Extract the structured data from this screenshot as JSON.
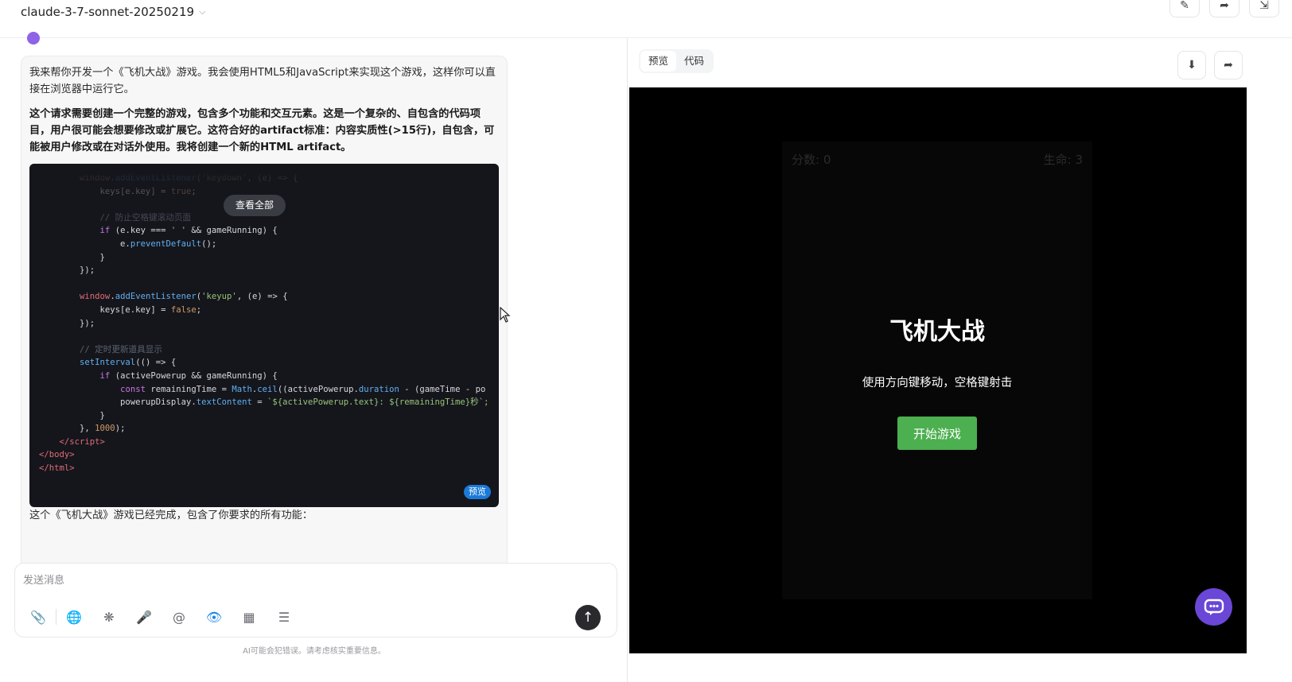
{
  "header": {
    "model_name": "claude-3-7-sonnet-20250219"
  },
  "message": {
    "intro": "我来帮你开发一个《飞机大战》游戏。我会使用HTML5和JavaScript来实现这个游戏，这样你可以直接在浏览器中运行它。",
    "bold_note": "这个请求需要创建一个完整的游戏，包含多个功能和交互元素。这是一个复杂的、自包含的代码项目，用户很可能会想要修改或扩展它。这符合好的artifact标准：内容实质性(>15行)，自包含，可能被用户修改或在对话外使用。我将创建一个新的HTML artifact。",
    "view_all_label": "查看全部",
    "preview_badge": "预览",
    "after_text": "这个《飞机大战》游戏已经完成，包含了你要求的所有功能："
  },
  "input": {
    "placeholder": "发送消息"
  },
  "disclaimer": "AI可能会犯错误。请考虑核实重要信息。",
  "preview_panel": {
    "tabs": [
      {
        "label": "预览"
      },
      {
        "label": "代码"
      }
    ]
  },
  "game": {
    "score_label": "分数: 0",
    "lives_label": "生命: 3",
    "title": "飞机大战",
    "hint": "使用方向键移动，空格键射击",
    "start_label": "开始游戏"
  }
}
